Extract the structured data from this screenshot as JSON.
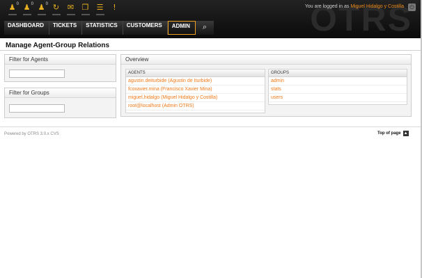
{
  "header": {
    "watermark": "OTRS",
    "login_prefix": "You are logged in as",
    "user_name": "Miguel Hidalgo y Costilla",
    "toolbar": [
      {
        "icon": "locked-tickets-icon",
        "glyph": "♟",
        "count": "0"
      },
      {
        "icon": "watched-tickets-icon",
        "glyph": "♟",
        "count": "0"
      },
      {
        "icon": "responsible-tickets-icon",
        "glyph": "♟",
        "count": "0"
      },
      {
        "icon": "refresh-icon",
        "glyph": "↻",
        "count": ""
      },
      {
        "icon": "new-phone-ticket-icon",
        "glyph": "✉",
        "count": ""
      },
      {
        "icon": "new-email-ticket-icon",
        "glyph": "❐",
        "count": ""
      },
      {
        "icon": "queue-view-icon",
        "glyph": "☰",
        "count": ""
      },
      {
        "icon": "escalation-icon",
        "glyph": "!",
        "count": ""
      }
    ]
  },
  "nav": {
    "items": [
      "DASHBOARD",
      "TICKETS",
      "STATISTICS",
      "CUSTOMERS",
      "ADMIN"
    ],
    "active": "ADMIN"
  },
  "page": {
    "title": "Manage Agent-Group Relations"
  },
  "filters": {
    "agents_title": "Filter for Agents",
    "groups_title": "Filter for Groups",
    "agents_value": "",
    "groups_value": ""
  },
  "overview": {
    "title": "Overview",
    "agents_header": "AGENTS",
    "groups_header": "GROUPS",
    "agents": [
      "agustin.deiturbide (Agustin de Iturbide)",
      "fcoxavier.mina (Francisco Xavier Mina)",
      "miguel.hidalgo (Miguel Hidalgo y Costilla)",
      "root@localhost (Admin OTRS)"
    ],
    "groups": [
      "admin",
      "stats",
      "users"
    ]
  },
  "footer": {
    "powered": "Powered by OTRS 3.0.x CVS",
    "top_link": "Top of page"
  },
  "colors": {
    "accent": "#f07a1a",
    "header_bg": "#111111"
  }
}
